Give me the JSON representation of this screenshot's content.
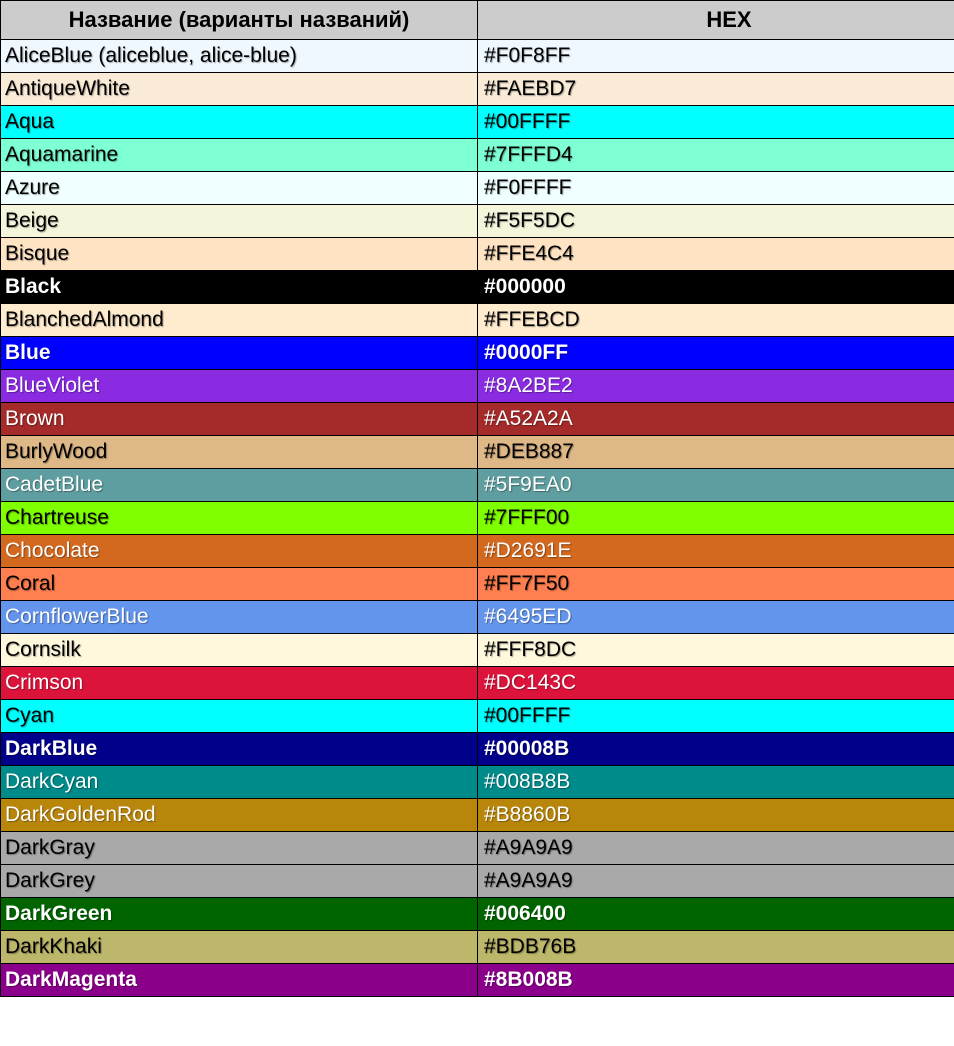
{
  "headers": {
    "name": "Название (варианты названий)",
    "hex": "HEX"
  },
  "rows": [
    {
      "name": "AliceBlue (aliceblue, alice-blue)",
      "hex": "#F0F8FF",
      "bg": "#F0F8FF",
      "fg": "#000000",
      "bold": false
    },
    {
      "name": "AntiqueWhite",
      "hex": "#FAEBD7",
      "bg": "#FAEBD7",
      "fg": "#000000",
      "bold": false
    },
    {
      "name": "Aqua",
      "hex": "#00FFFF",
      "bg": "#00FFFF",
      "fg": "#000000",
      "bold": false
    },
    {
      "name": "Aquamarine",
      "hex": "#7FFFD4",
      "bg": "#7FFFD4",
      "fg": "#000000",
      "bold": false
    },
    {
      "name": "Azure",
      "hex": "#F0FFFF",
      "bg": "#F0FFFF",
      "fg": "#000000",
      "bold": false
    },
    {
      "name": "Beige",
      "hex": "#F5F5DC",
      "bg": "#F5F5DC",
      "fg": "#000000",
      "bold": false
    },
    {
      "name": "Bisque",
      "hex": "#FFE4C4",
      "bg": "#FFE4C4",
      "fg": "#000000",
      "bold": false
    },
    {
      "name": "Black",
      "hex": "#000000",
      "bg": "#000000",
      "fg": "#FFFFFF",
      "bold": true
    },
    {
      "name": "BlanchedAlmond",
      "hex": "#FFEBCD",
      "bg": "#FFEBCD",
      "fg": "#000000",
      "bold": false
    },
    {
      "name": "Blue",
      "hex": "#0000FF",
      "bg": "#0000FF",
      "fg": "#FFFFFF",
      "bold": true
    },
    {
      "name": "BlueViolet",
      "hex": "#8A2BE2",
      "bg": "#8A2BE2",
      "fg": "#FFFFFF",
      "bold": false
    },
    {
      "name": "Brown",
      "hex": "#A52A2A",
      "bg": "#A52A2A",
      "fg": "#FFFFFF",
      "bold": false
    },
    {
      "name": "BurlyWood",
      "hex": "#DEB887",
      "bg": "#DEB887",
      "fg": "#000000",
      "bold": false
    },
    {
      "name": "CadetBlue",
      "hex": "#5F9EA0",
      "bg": "#5F9EA0",
      "fg": "#FFFFFF",
      "bold": false
    },
    {
      "name": "Chartreuse",
      "hex": "#7FFF00",
      "bg": "#7FFF00",
      "fg": "#000000",
      "bold": false
    },
    {
      "name": "Chocolate",
      "hex": "#D2691E",
      "bg": "#D2691E",
      "fg": "#FFFFFF",
      "bold": false
    },
    {
      "name": "Coral",
      "hex": "#FF7F50",
      "bg": "#FF7F50",
      "fg": "#000000",
      "bold": false
    },
    {
      "name": "CornflowerBlue",
      "hex": "#6495ED",
      "bg": "#6495ED",
      "fg": "#FFFFFF",
      "bold": false
    },
    {
      "name": "Cornsilk",
      "hex": "#FFF8DC",
      "bg": "#FFF8DC",
      "fg": "#000000",
      "bold": false
    },
    {
      "name": "Crimson",
      "hex": "#DC143C",
      "bg": "#DC143C",
      "fg": "#FFFFFF",
      "bold": false
    },
    {
      "name": "Cyan",
      "hex": "#00FFFF",
      "bg": "#00FFFF",
      "fg": "#000000",
      "bold": false
    },
    {
      "name": "DarkBlue",
      "hex": "#00008B",
      "bg": "#00008B",
      "fg": "#FFFFFF",
      "bold": true
    },
    {
      "name": "DarkCyan",
      "hex": "#008B8B",
      "bg": "#008B8B",
      "fg": "#FFFFFF",
      "bold": false
    },
    {
      "name": "DarkGoldenRod",
      "hex": "#B8860B",
      "bg": "#B8860B",
      "fg": "#FFFFFF",
      "bold": false
    },
    {
      "name": "DarkGray",
      "hex": "#A9A9A9",
      "bg": "#A9A9A9",
      "fg": "#000000",
      "bold": false
    },
    {
      "name": "DarkGrey",
      "hex": "#A9A9A9",
      "bg": "#A9A9A9",
      "fg": "#000000",
      "bold": false
    },
    {
      "name": "DarkGreen",
      "hex": "#006400",
      "bg": "#006400",
      "fg": "#FFFFFF",
      "bold": true
    },
    {
      "name": "DarkKhaki",
      "hex": "#BDB76B",
      "bg": "#BDB76B",
      "fg": "#000000",
      "bold": false
    },
    {
      "name": "DarkMagenta",
      "hex": "#8B008B",
      "bg": "#8B008B",
      "fg": "#FFFFFF",
      "bold": true
    }
  ]
}
